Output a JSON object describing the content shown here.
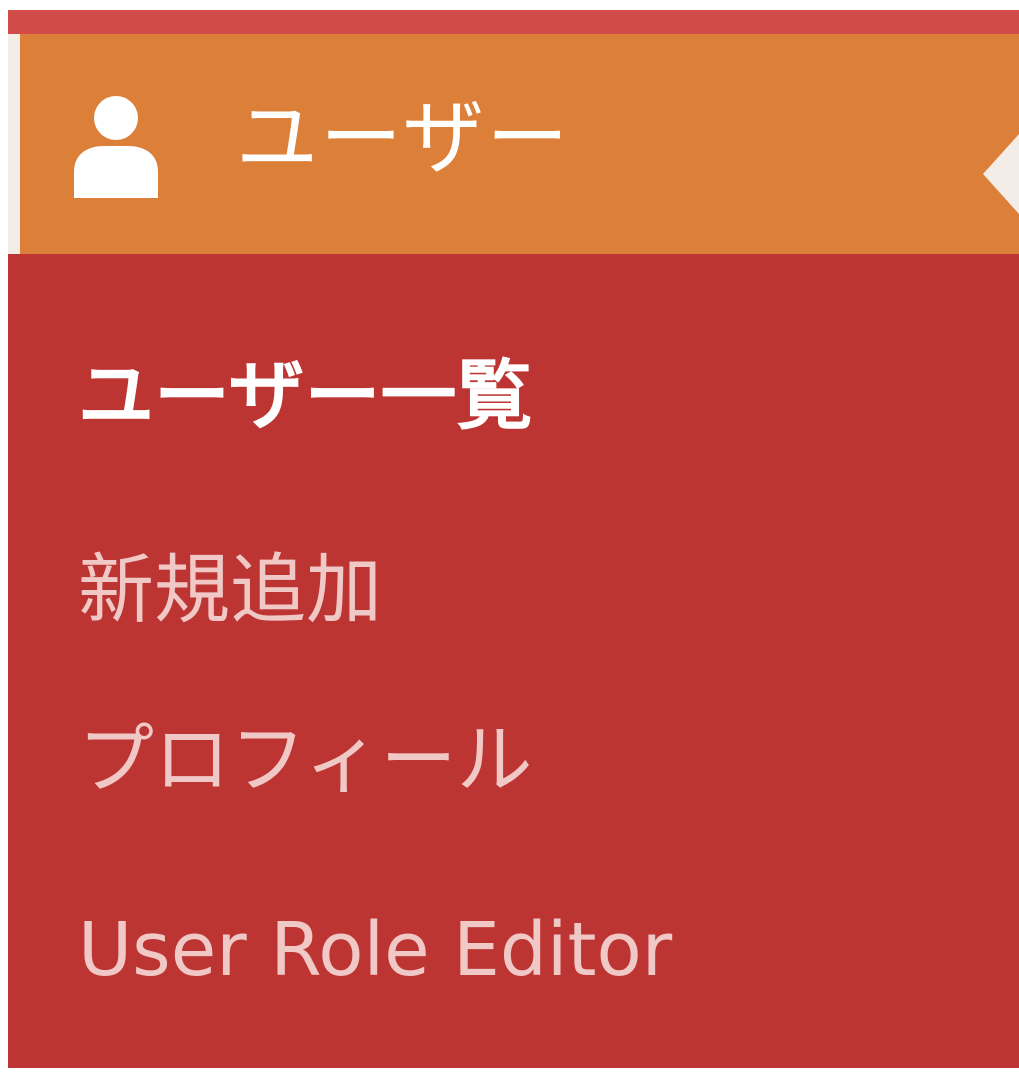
{
  "menu": {
    "header": {
      "icon": "user-icon",
      "label": "ユーザー"
    },
    "items": [
      {
        "label": "ユーザー一覧",
        "current": true
      },
      {
        "label": "新規追加",
        "current": false
      },
      {
        "label": "プロフィール",
        "current": false
      },
      {
        "label": "User Role Editor",
        "current": false
      }
    ]
  },
  "colors": {
    "menu_background": "#bd3533",
    "top_strip": "#d14b49",
    "header_background": "#dc8039",
    "current_text": "#ffffff",
    "submenu_text": "#f0c8c6",
    "arrow": "#f3ece7"
  }
}
